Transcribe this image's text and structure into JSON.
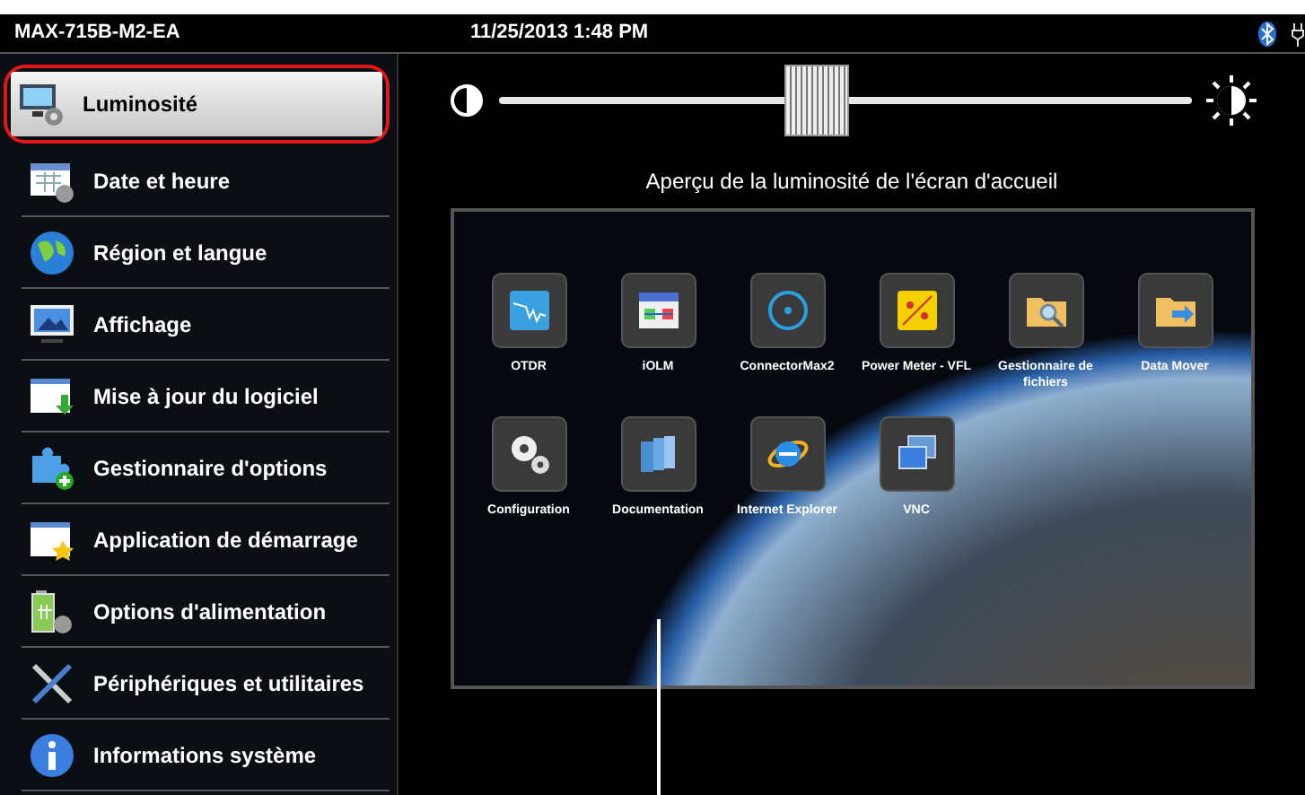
{
  "status_bar": {
    "device": "MAX-715B-M2-EA",
    "datetime": "11/25/2013 1:48 PM"
  },
  "sidebar": {
    "items": [
      {
        "label": "Luminosité",
        "selected": true
      },
      {
        "label": "Date et heure",
        "selected": false
      },
      {
        "label": "Région et langue",
        "selected": false
      },
      {
        "label": "Affichage",
        "selected": false
      },
      {
        "label": "Mise à jour du logiciel",
        "selected": false
      },
      {
        "label": "Gestionnaire d'options",
        "selected": false
      },
      {
        "label": "Application de démarrage",
        "selected": false
      },
      {
        "label": "Options d'alimentation",
        "selected": false
      },
      {
        "label": "Périphériques et utilitaires",
        "selected": false
      },
      {
        "label": "Informations système",
        "selected": false
      }
    ]
  },
  "brightness": {
    "level": 0.46,
    "preview_caption": "Aperçu de la luminosité de l'écran d'accueil"
  },
  "preview": {
    "apps": [
      {
        "label": "OTDR"
      },
      {
        "label": "iOLM"
      },
      {
        "label": "ConnectorMax2"
      },
      {
        "label": "Power Meter - VFL"
      },
      {
        "label": "Gestionnaire de fichiers"
      },
      {
        "label": "Data Mover"
      },
      {
        "label": "Configuration"
      },
      {
        "label": "Documentation"
      },
      {
        "label": "Internet Explorer"
      },
      {
        "label": "VNC"
      }
    ]
  }
}
